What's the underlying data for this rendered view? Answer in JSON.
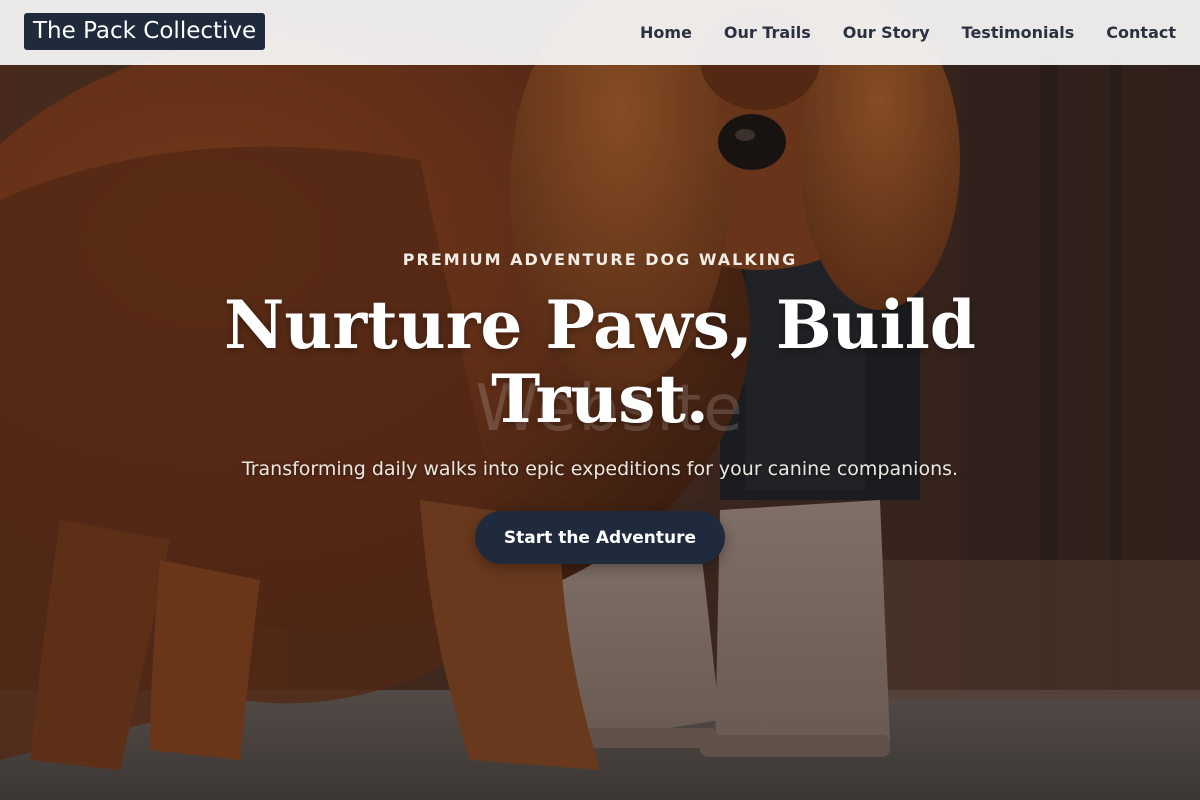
{
  "header": {
    "logo_text": "The Pack Collective",
    "nav": [
      {
        "label": "Home"
      },
      {
        "label": "Our Trails"
      },
      {
        "label": "Our Story"
      },
      {
        "label": "Testimonials"
      },
      {
        "label": "Contact"
      }
    ]
  },
  "hero": {
    "eyebrow": "PREMIUM ADVENTURE DOG WALKING",
    "headline": "Nurture Paws, Build Trust.",
    "watermark": "Website",
    "subheadline": "Transforming daily walks into epic expeditions for your canine companions.",
    "cta_label": "Start the Adventure",
    "image": "hero-dog-walking-photo"
  },
  "colors": {
    "brand_navy": "#1f2a3c",
    "header_bg": "#f5f5f5",
    "nav_text": "#2a3140",
    "hero_text": "#ffffff"
  }
}
